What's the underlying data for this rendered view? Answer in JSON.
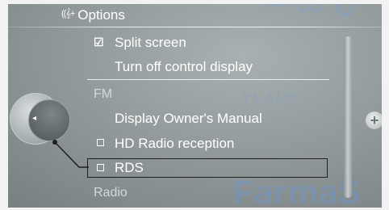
{
  "header": {
    "antenna_icon": "antenna-icon",
    "title": "Options"
  },
  "menu": {
    "split_screen": {
      "label": "Split screen",
      "checked": true
    },
    "turn_off_display": {
      "label": "Turn off control display"
    },
    "section_fm": "FM",
    "owners_manual": {
      "label": "Display Owner's Manual"
    },
    "hd_radio": {
      "label": "HD Radio reception",
      "checked": false
    },
    "rds": {
      "label": "RDS",
      "checked": false,
      "selected": true
    },
    "section_radio": "Radio"
  },
  "controls": {
    "left_arrow": "◂",
    "plus": "+"
  },
  "watermark": {
    "phone": "۰۲۱-۸۸۴۲۰",
    "brand": "FarmaS"
  },
  "colors": {
    "highlight_border": "#1e1e1e",
    "text": "#ffffff",
    "background": "#8d9496"
  }
}
